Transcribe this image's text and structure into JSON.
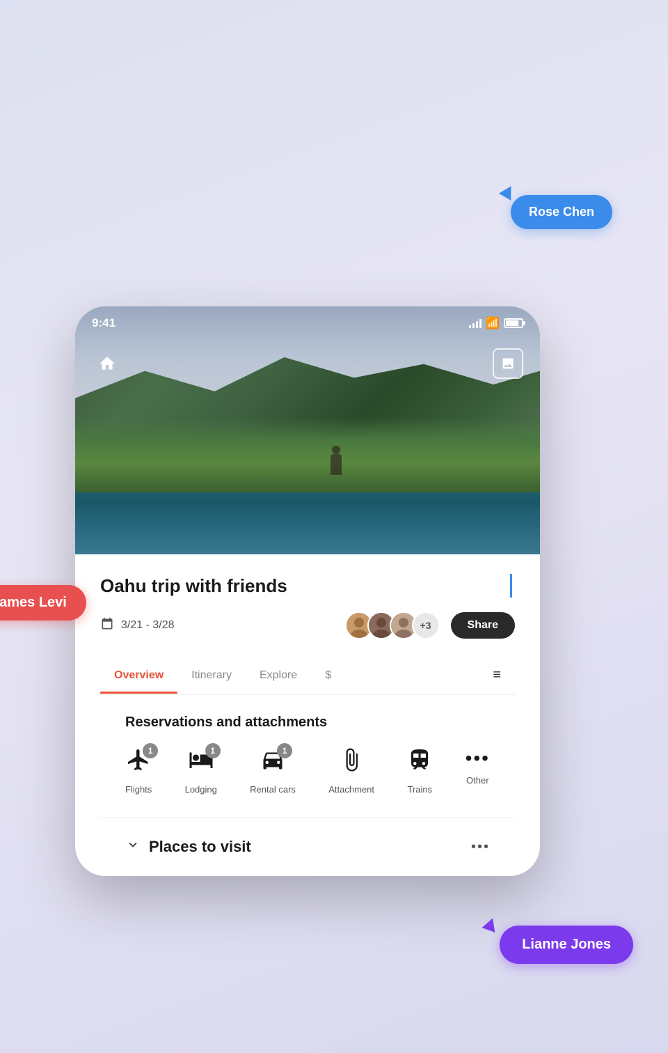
{
  "app": {
    "status_bar": {
      "time": "9:41",
      "signal": "signal",
      "wifi": "wifi",
      "battery": "battery"
    },
    "hero": {
      "home_icon": "🏠",
      "gallery_icon": "🖼"
    },
    "trip": {
      "title": "Oahu trip with friends",
      "date_range": "3/21 - 3/28",
      "avatar_count": "+3",
      "share_label": "Share"
    },
    "nav_tabs": [
      {
        "label": "Overview",
        "active": true
      },
      {
        "label": "Itinerary",
        "active": false
      },
      {
        "label": "Explore",
        "active": false
      },
      {
        "label": "$",
        "active": false
      }
    ],
    "menu_icon": "≡",
    "sections": {
      "reservations": {
        "title": "Reservations and attachments",
        "items": [
          {
            "icon": "✈",
            "label": "Flights",
            "badge": "1"
          },
          {
            "icon": "🛏",
            "label": "Lodging",
            "badge": "1"
          },
          {
            "icon": "🚗",
            "label": "Rental cars",
            "badge": "1"
          },
          {
            "icon": "📎",
            "label": "Attachment",
            "badge": null
          },
          {
            "icon": "🚌",
            "label": "Trains",
            "badge": null
          },
          {
            "icon": "•••",
            "label": "Other",
            "badge": null
          }
        ]
      },
      "places": {
        "title": "Places to visit",
        "more_icon": "•••"
      }
    },
    "bubbles": {
      "rose": "Rose Chen",
      "james": "James Levi",
      "lianne": "Lianne Jones"
    }
  }
}
